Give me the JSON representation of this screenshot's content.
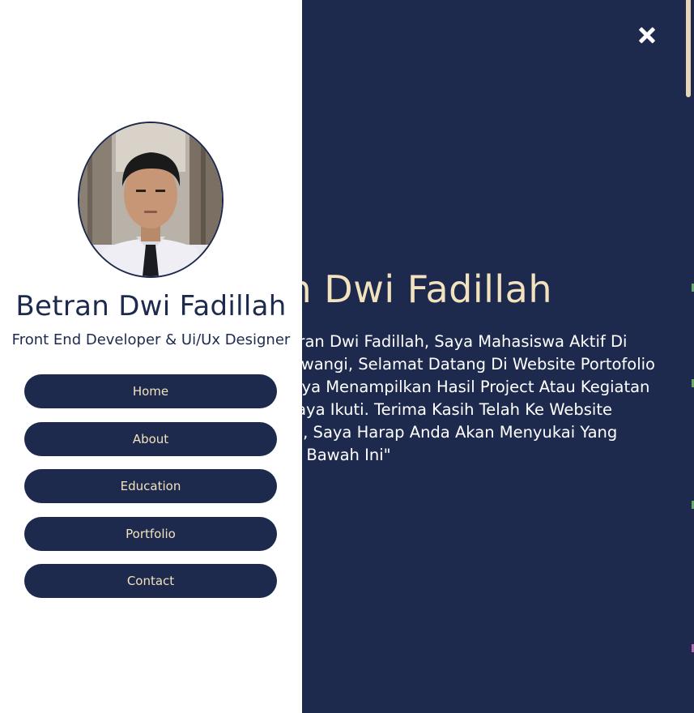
{
  "hero": {
    "title": "Betran Dwi Fadillah",
    "description": "\"Hai, Saya Betran Dwi Fadillah, Saya Mahasiswa Aktif Di Universitas Siliwangi, Selamat Datang Di Website Portofolio Saya, Disini Saya Menampilkan Hasil Project Atau Kegiatan Yang Pernah Saya Ikuti. Terima Kasih Telah Ke Website Portofolio Saya, Saya Harap Anda Akan Menyukai Yang Ditampilkan Di Bawah Ini\""
  },
  "drawer": {
    "name": "Betran Dwi Fadillah",
    "role": "Front End Developer & Ui/Ux Designer",
    "nav": [
      "Home",
      "About",
      "Education",
      "Portfolio",
      "Contact"
    ]
  },
  "colors": {
    "navy": "#1d2a4d",
    "cream": "#f2e2bd",
    "white": "#ffffff"
  },
  "icons": {
    "close": "close-icon"
  }
}
